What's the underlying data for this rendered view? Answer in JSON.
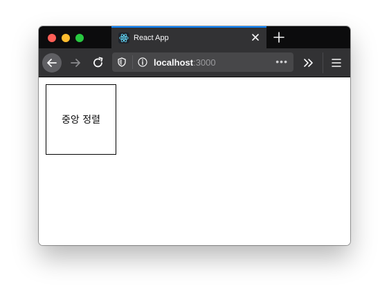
{
  "browser": {
    "tab": {
      "title": "React App",
      "favicon": "react-logo-icon"
    },
    "url": {
      "host": "localhost",
      "port": ":3000"
    },
    "page_actions": "•••",
    "accent_color": "#0a84ff"
  },
  "page": {
    "box_text": "중앙 정렬"
  }
}
